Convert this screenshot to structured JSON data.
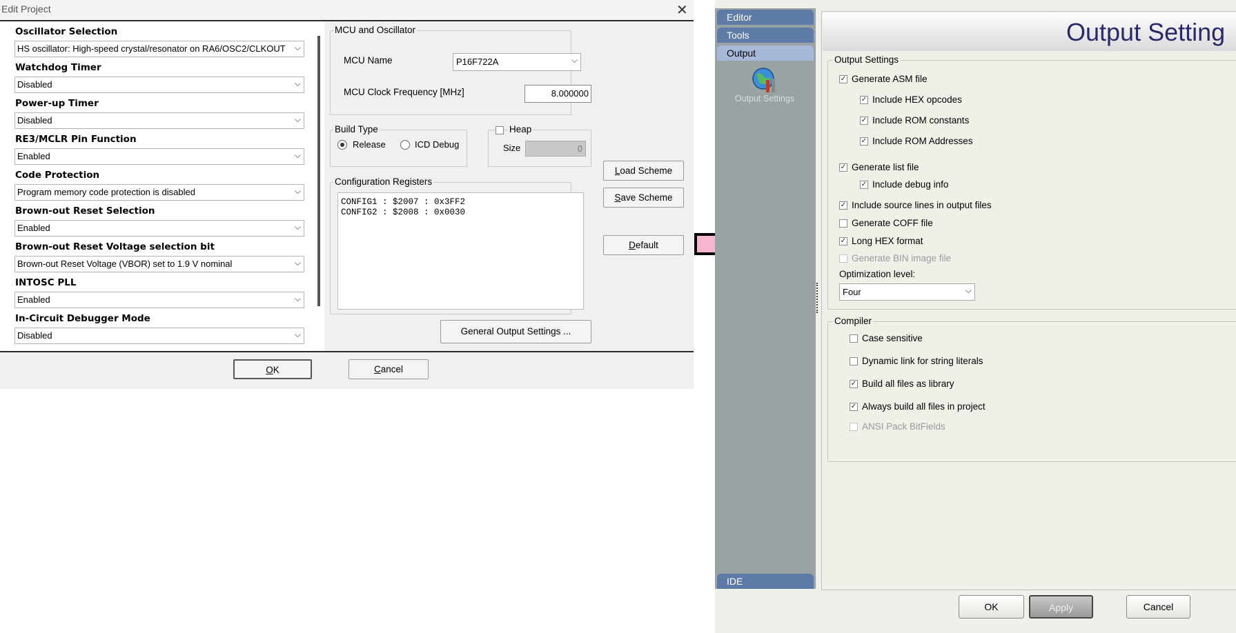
{
  "edit_project": {
    "title": "Edit Project",
    "close_glyph": "✕",
    "config_items": [
      {
        "label": "Oscillator Selection",
        "value": "HS oscillator: High-speed crystal/resonator on RA6/OSC2/CLKOUT"
      },
      {
        "label": "Watchdog Timer",
        "value": "Disabled"
      },
      {
        "label": "Power-up Timer",
        "value": "Disabled"
      },
      {
        "label": "RE3/MCLR Pin Function",
        "value": "Enabled"
      },
      {
        "label": "Code Protection",
        "value": "Program memory code protection is disabled"
      },
      {
        "label": "Brown-out Reset Selection",
        "value": "Enabled"
      },
      {
        "label": "Brown-out Reset Voltage selection bit",
        "value": "Brown-out Reset Voltage (VBOR) set to 1.9 V nominal"
      },
      {
        "label": "INTOSC PLL",
        "value": "Enabled"
      },
      {
        "label": "In-Circuit Debugger Mode",
        "value": "Disabled"
      }
    ],
    "mcu_group": {
      "title": "MCU and Oscillator",
      "mcu_name_label": "MCU Name",
      "mcu_name_value": "P16F722A",
      "clock_label": "MCU Clock Frequency [MHz]",
      "clock_value": "8.000000"
    },
    "build_type": {
      "title": "Build Type",
      "release_label": "Release",
      "icd_label": "ICD Debug",
      "selected": "Release"
    },
    "heap": {
      "title": "Heap",
      "checked": false,
      "size_label": "Size",
      "size_value": "0"
    },
    "config_registers": {
      "title": "Configuration Registers",
      "lines": [
        "CONFIG1 : $2007 : 0x3FF2",
        "CONFIG2 : $2008 : 0x0030"
      ]
    },
    "buttons": {
      "load_scheme_mn": "L",
      "load_scheme_rest": "oad Scheme",
      "save_scheme_mn": "S",
      "save_scheme_rest": "ave Scheme",
      "default_mn": "D",
      "default_rest": "efault",
      "general_output": "General Output Settings ...",
      "ok_mn": "O",
      "ok_rest": "K",
      "cancel_mn": "C",
      "cancel_rest": "ancel"
    }
  },
  "options": {
    "sidebar": {
      "tabs": [
        "Editor",
        "Tools",
        "Output"
      ],
      "active": "Output",
      "icon_label": "Output Settings",
      "bottom_tab": "IDE"
    },
    "header_title": "Output Setting",
    "output_settings": {
      "title": "Output Settings",
      "items": [
        {
          "label": "Generate ASM file",
          "checked": true,
          "enabled": true
        },
        {
          "label": "Include HEX opcodes",
          "checked": true,
          "enabled": true
        },
        {
          "label": "Include ROM constants",
          "checked": true,
          "enabled": true
        },
        {
          "label": "Include ROM Addresses",
          "checked": true,
          "enabled": true
        },
        {
          "label": "Generate list file",
          "checked": true,
          "enabled": true
        },
        {
          "label": "Include debug info",
          "checked": true,
          "enabled": true
        },
        {
          "label": "Include source lines in output files",
          "checked": true,
          "enabled": true
        },
        {
          "label": "Generate COFF file",
          "checked": false,
          "enabled": true
        },
        {
          "label": "Long HEX format",
          "checked": true,
          "enabled": true
        },
        {
          "label": "Generate BIN image file",
          "checked": false,
          "enabled": false
        }
      ],
      "optimization_label": "Optimization level:",
      "optimization_value": "Four"
    },
    "compiler": {
      "title": "Compiler",
      "items": [
        {
          "label": "Case sensitive",
          "checked": false,
          "enabled": true
        },
        {
          "label": "Dynamic link for string literals",
          "checked": false,
          "enabled": true
        },
        {
          "label": "Build all files as library",
          "checked": true,
          "enabled": true
        },
        {
          "label": "Always build all files in project",
          "checked": true,
          "enabled": true
        },
        {
          "label": "ANSI Pack BitFields",
          "checked": false,
          "enabled": false
        }
      ]
    },
    "buttons": {
      "ok": "OK",
      "apply": "Apply",
      "cancel": "Cancel"
    }
  },
  "colors": {
    "arrow_fill": "#f7b6cf",
    "sidebar_tab": "#5d7ba6",
    "header_title": "#2a2a6a"
  }
}
